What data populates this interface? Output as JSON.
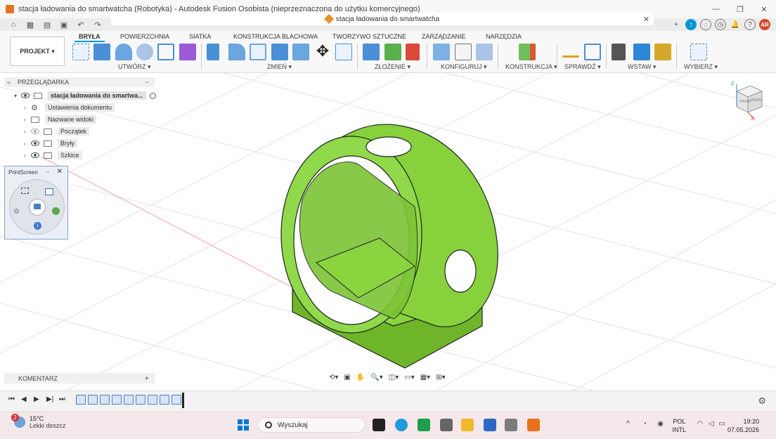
{
  "window": {
    "title": "stacja ładowania do smartwatcha (Robotyka) - Autodesk Fusion Osobista (nieprzeznaczona do użytku komercyjnego)",
    "minimize": "—",
    "maximize": "❐",
    "close": "✕"
  },
  "doc_tab": {
    "label": "stacja ładowania do smartwatcha",
    "close": "✕"
  },
  "user": {
    "initials": "AR"
  },
  "toolbar": {
    "projekt_label": "PROJEKT ▾",
    "tabs": [
      "BRYŁA",
      "POWIERZCHNIA",
      "SIATKA",
      "KONSTRUKCJA BLACHOWA",
      "TWORZYWO SZTUCZNE",
      "ZARZĄDZANIE",
      "NARZĘDZIA"
    ],
    "groups": [
      "UTWÓRZ ▾",
      "ZMIEŃ ▾",
      "ZŁOŻENIE ▾",
      "KONFIGURUJ ▾",
      "KONSTRUKCJA ▾",
      "SPRAWDŹ ▾",
      "WSTAW ▾",
      "WYBIERZ ▾"
    ]
  },
  "browser": {
    "title": "PRZEGLĄDARKA",
    "collapse": "−",
    "root": "stacja ładowania do smartwa...",
    "items": [
      "Ustawienia dokumentu",
      "Nazwane widoki",
      "Początek",
      "Bryły",
      "Szkice"
    ]
  },
  "printscreen": {
    "title": "PrintScreen",
    "close": "✕"
  },
  "comments": {
    "label": "KOMENTARZ",
    "add": "+"
  },
  "viewcube": {
    "front": "FRONT",
    "right": "RIGHT",
    "axis_z": "Z",
    "axis_x": "X"
  },
  "taskbar": {
    "weather_temp": "15°C",
    "weather_desc": "Lekki deszcz",
    "weather_badge": "2",
    "search_placeholder": "Wyszukaj",
    "lang1": "POL",
    "lang2": "INTL",
    "time": "19:20",
    "date": "07.05.2026"
  },
  "colors": {
    "model": "#86d13c",
    "accent": "#0696d7"
  }
}
